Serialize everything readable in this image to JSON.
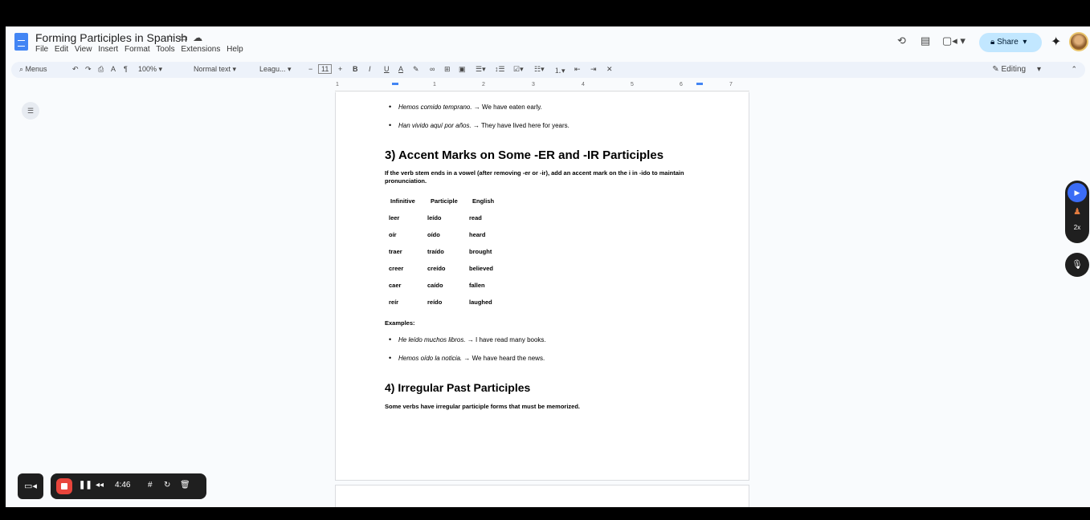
{
  "doc": {
    "title": "Forming Participles in Spanish"
  },
  "menu": [
    "File",
    "Edit",
    "View",
    "Insert",
    "Format",
    "Tools",
    "Extensions",
    "Help"
  ],
  "header": {
    "share_label": "Share"
  },
  "toolbar": {
    "menus_label": "Menus",
    "zoom": "100%",
    "style": "Normal text",
    "font": "Leagu...",
    "font_size": "11",
    "editing_label": "Editing"
  },
  "ruler": [
    "1",
    "1",
    "2",
    "3",
    "4",
    "5",
    "6",
    "7"
  ],
  "content": {
    "bullets_top": [
      {
        "italic": "Hemos comido temprano.",
        "rest": " → We have eaten early."
      },
      {
        "italic": "Han vivido aquí por años.",
        "rest": " → They have lived here for years."
      }
    ],
    "heading3": "3) Accent Marks on Some -ER and -IR Participles",
    "para3": "If the verb stem ends in a vowel (after removing -er or -ir), add an accent mark on the i in -ido to maintain pronunciation.",
    "table": {
      "headers": [
        "Infinitive",
        "Participle",
        "English"
      ],
      "rows": [
        [
          "leer",
          "leído",
          "read"
        ],
        [
          "oír",
          "oído",
          "heard"
        ],
        [
          "traer",
          "traído",
          "brought"
        ],
        [
          "creer",
          "creído",
          "believed"
        ],
        [
          "caer",
          "caído",
          "fallen"
        ],
        [
          "reír",
          "reído",
          "laughed"
        ]
      ]
    },
    "examples_label": "Examples:",
    "bullets_bottom": [
      {
        "italic": "He leído muchos libros.",
        "rest": " → I have read many books."
      },
      {
        "italic": "Hemos oído la noticia.",
        "rest": " → We have heard the news."
      }
    ],
    "heading4": "4) Irregular Past Participles",
    "para4": "Some verbs have irregular participle forms that must be memorized."
  },
  "side_panel": {
    "speed": "2x"
  },
  "recorder": {
    "time": "4:46"
  },
  "icons": {
    "star": "star-icon",
    "folder": "folder-icon",
    "cloud": "cloud-icon",
    "history": "history-icon",
    "comment": "comment-icon",
    "meet": "video-call-icon",
    "gemini": "gemini-icon",
    "lock": "lock-icon",
    "pencil": "pencil-icon"
  },
  "colors": {
    "accent": "#4285f4",
    "share_bg": "#c2e7ff",
    "record": "#e8453c"
  }
}
